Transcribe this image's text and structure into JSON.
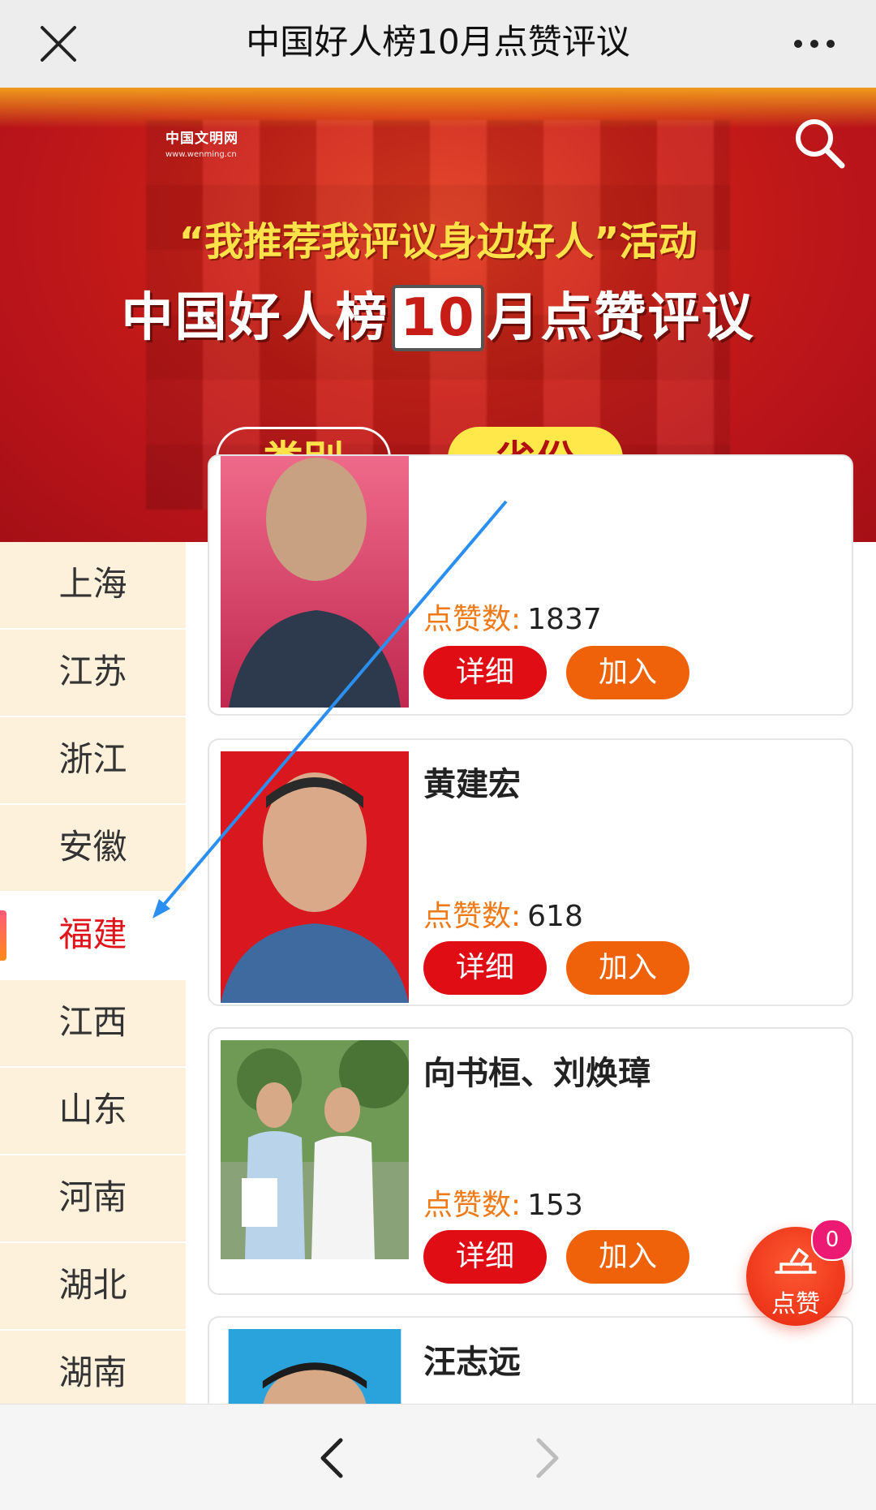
{
  "header": {
    "title": "中国好人榜10月点赞评议",
    "close_icon": "close-icon",
    "more_icon": "more-icon"
  },
  "banner": {
    "brand_name": "中国文明网",
    "brand_url": "www.wenming.cn",
    "slogan": "“我推荐我评议身边好人”活动",
    "headline_pre": "中国好人榜",
    "headline_num": "10",
    "headline_post": "月点赞评议",
    "category_label": "类别",
    "province_label": "省份"
  },
  "sidebar": {
    "items": [
      {
        "label": "上海",
        "active": false
      },
      {
        "label": "江苏",
        "active": false
      },
      {
        "label": "浙江",
        "active": false
      },
      {
        "label": "安徽",
        "active": false
      },
      {
        "label": "福建",
        "active": true
      },
      {
        "label": "江西",
        "active": false
      },
      {
        "label": "山东",
        "active": false
      },
      {
        "label": "河南",
        "active": false
      },
      {
        "label": "湖北",
        "active": false
      },
      {
        "label": "湖南",
        "active": false
      }
    ]
  },
  "cards": [
    {
      "name": "",
      "likes_label": "点赞数:",
      "likes": "1837",
      "detail_label": "详细",
      "join_label": "加入"
    },
    {
      "name": "黄建宏",
      "likes_label": "点赞数:",
      "likes": "618",
      "detail_label": "详细",
      "join_label": "加入"
    },
    {
      "name": "向书桓、刘焕璋",
      "likes_label": "点赞数:",
      "likes": "153",
      "detail_label": "详细",
      "join_label": "加入"
    },
    {
      "name": "汪志远",
      "likes_label": "",
      "likes": "",
      "detail_label": "",
      "join_label": ""
    }
  ],
  "fab": {
    "label": "点赞",
    "badge": "0"
  },
  "colors": {
    "accent_red": "#e00d14",
    "accent_orange": "#f0620a",
    "sidebar_bg": "#fdf1dc",
    "badge": "#ec1a72"
  }
}
